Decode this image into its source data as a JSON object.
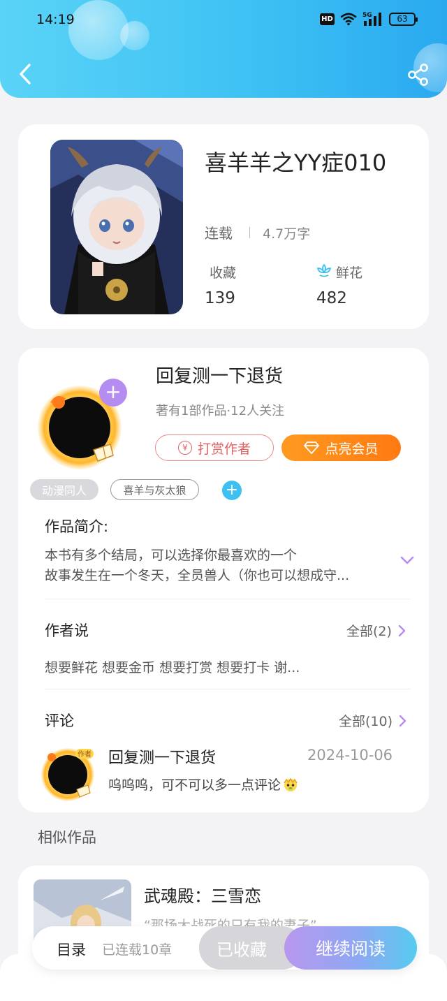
{
  "status_bar": {
    "time": "14:19",
    "hd": "HD",
    "network": "5G",
    "battery": "63"
  },
  "book": {
    "title": "喜羊羊之YY症010",
    "status": "连载",
    "words": "4.7万字",
    "favorites_label": "收藏",
    "favorites_count": "139",
    "flowers_label": "鲜花",
    "flowers_count": "482"
  },
  "author": {
    "name": "回复测一下退货",
    "meta": "著有1部作品·12人关注",
    "tip_label": "打赏作者",
    "tip_icon_text": "¥",
    "vip_label": "点亮会员",
    "tags": [
      "动漫同人",
      "喜羊与灰太狼"
    ]
  },
  "intro": {
    "title": "作品简介:",
    "line1": "本书有多个结局，可以选择你最喜欢的一个",
    "line2": "故事发生在一个冬天，全员兽人（你也可以想成守..."
  },
  "author_says": {
    "title": "作者说",
    "all_label": "全部(2)",
    "text": "想要鲜花 想要金币 想要打赏 想要打卡 谢..."
  },
  "comments": {
    "title": "评论",
    "all_label": "全部(10)",
    "items": [
      {
        "name": "回复测一下退货",
        "date": "2024-10-06",
        "text": "呜呜呜，可不可以多一点评论",
        "badge": "作者"
      }
    ]
  },
  "similar": {
    "title": "相似作品",
    "items": [
      {
        "title": "武魂殿：三雪恋",
        "desc": "“那场大战死的只有我的妻子”"
      }
    ]
  },
  "bottom_bar": {
    "toc_label": "目录",
    "toc_count": "已连载10章",
    "collected_label": "已收藏",
    "read_label": "继续阅读"
  },
  "colors": {
    "header_start": "#5ad3f7",
    "header_end": "#2aa9f0",
    "vip_orange": "#ff8a18",
    "tip_red": "#e36363",
    "accent_purple": "#b58cf0",
    "accent_blue": "#3ec0f0"
  },
  "icons": [
    "back-arrow-icon",
    "share-icon",
    "flower-icon",
    "yen-icon",
    "diamond-icon",
    "plus-icon",
    "chevron-down-icon",
    "chevron-right-icon"
  ]
}
